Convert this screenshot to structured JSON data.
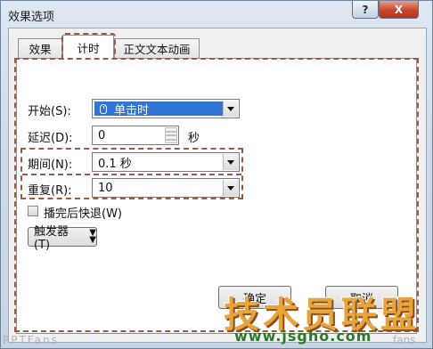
{
  "window": {
    "title": "效果选项"
  },
  "titlebar_buttons": {
    "help": "?",
    "close": "X"
  },
  "tabs": [
    {
      "label": "效果"
    },
    {
      "label": "计时"
    },
    {
      "label": "正文文本动画"
    }
  ],
  "timing": {
    "start_label": "开始(S):",
    "start_value": "单击时",
    "delay_label": "延迟(D):",
    "delay_value": "0",
    "delay_unit": "秒",
    "duration_label": "期间(N):",
    "duration_value": "0.1 秒",
    "repeat_label": "重复(R):",
    "repeat_value": "10",
    "rewind_label": "播完后快退(W)",
    "rewind_checked": false,
    "trigger_label": "触发器(T)"
  },
  "buttons": {
    "ok": "确定",
    "cancel": "取消"
  },
  "watermark": {
    "logo": "技术员联盟",
    "url": "www.jsgho.com",
    "left": "PPTFans",
    "right": "fans"
  },
  "colors": {
    "highlight_dash": "#9a5a45",
    "selection": "#3074d6",
    "close": "#c6462d"
  }
}
